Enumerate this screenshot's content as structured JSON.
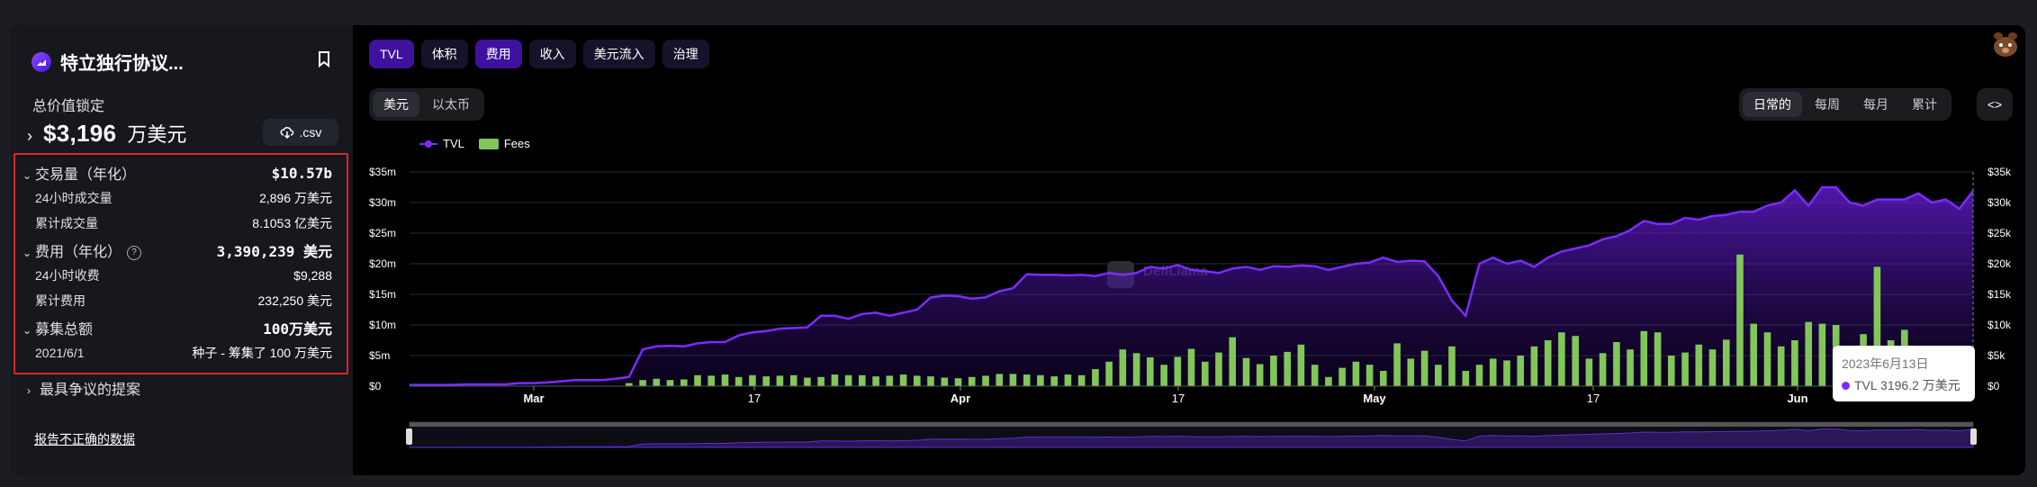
{
  "protocol": {
    "name": "特立独行协议..."
  },
  "sidebar": {
    "tvl_label": "总价值锁定",
    "tvl_value": "$3,196",
    "tvl_unit": "万美元",
    "csv_label": ".csv",
    "stats": {
      "volume_label": "交易量（年化）",
      "volume_value": "$10.57b",
      "volume_24h_label": "24小时成交量",
      "volume_24h_value": "2,896 万美元",
      "volume_cum_label": "累计成交量",
      "volume_cum_value": "8.1053 亿美元",
      "fees_label": "费用（年化）",
      "fees_value": "3,390,239 美元",
      "fees_24h_label": "24小时收费",
      "fees_24h_value": "$9,288",
      "fees_cum_label": "累计费用",
      "fees_cum_value": "232,250 美元",
      "raised_label": "募集总额",
      "raised_value": "100万美元",
      "round_date": "2021/6/1",
      "round_desc": "种子 - 筹集了 100 万美元"
    },
    "disputed_label": "最具争议的提案",
    "report_label": "报告不正确的数据"
  },
  "tabs": [
    "TVL",
    "体积",
    "费用",
    "收入",
    "美元流入",
    "治理"
  ],
  "currency_toggle": [
    "美元",
    "以太币"
  ],
  "period_toggle": [
    "日常的",
    "每周",
    "每月",
    "累计"
  ],
  "embed_label": "<>",
  "tooltip": {
    "date": "2023年6月13日",
    "value": "TVL 3196.2 万美元"
  },
  "colors": {
    "tvl": "#7b2cff",
    "fees": "#82c65a",
    "accent": "#3e129f",
    "highlight": "#e02525"
  },
  "chart_data": {
    "type": "area",
    "legend": [
      "TVL",
      "Fees"
    ],
    "x_ticks": [
      "Mar",
      "17",
      "Apr",
      "17",
      "May",
      "17",
      "Jun",
      "17"
    ],
    "y_left_ticks": [
      "$0",
      "$5m",
      "$10m",
      "$15m",
      "$20m",
      "$25m",
      "$30m",
      "$35m"
    ],
    "y_right_ticks": [
      "$0",
      "$5k",
      "$10k",
      "$15k",
      "$20k",
      "$25k",
      "$30k",
      "$35k"
    ],
    "y_left_range": [
      0,
      35
    ],
    "y_right_range": [
      0,
      35
    ],
    "watermark": "DefiLlama",
    "series": [
      {
        "name": "TVL",
        "unit": "$m",
        "values": [
          0.2,
          0.2,
          0.2,
          0.2,
          0.3,
          0.3,
          0.3,
          0.3,
          0.5,
          0.5,
          0.6,
          0.8,
          1,
          1,
          1,
          1.2,
          1.5,
          6,
          6.5,
          6.6,
          6.5,
          7,
          7.2,
          7.2,
          8.3,
          8.8,
          9,
          9.4,
          9.5,
          9.6,
          11.5,
          11.5,
          11,
          11.8,
          12,
          11.5,
          12,
          12.5,
          14.5,
          14.8,
          14.7,
          14.3,
          14.5,
          15.5,
          16,
          18.3,
          18.2,
          18.2,
          18.1,
          18.2,
          18,
          18.5,
          18.2,
          18.5,
          19.5,
          19.2,
          19.8,
          19,
          18.8,
          18.5,
          19.2,
          19.5,
          19,
          19.6,
          19.5,
          19.7,
          19.6,
          19,
          19.5,
          20,
          20.2,
          21,
          20.3,
          20.5,
          20.4,
          18,
          14,
          11.5,
          20,
          21,
          20,
          20.5,
          19.5,
          21,
          22,
          22.5,
          23,
          24,
          24.5,
          25.5,
          27,
          26.5,
          26.5,
          27.5,
          27.2,
          27.8,
          28,
          28.5,
          28.5,
          29.5,
          30,
          32,
          29.5,
          32.5,
          32.5,
          30,
          29.5,
          30.5,
          30.5,
          30.5,
          31.5,
          30,
          30.5,
          29,
          31.9
        ]
      },
      {
        "name": "Fees",
        "unit": "$k",
        "values": [
          0,
          0,
          0,
          0,
          0,
          0,
          0,
          0,
          0,
          0,
          0,
          0,
          0,
          0,
          0,
          0,
          0.5,
          1,
          1.2,
          1,
          1.1,
          1.8,
          1.7,
          1.9,
          1.5,
          1.8,
          1.6,
          1.7,
          1.8,
          1.4,
          1.5,
          1.9,
          1.8,
          1.8,
          1.6,
          1.7,
          1.9,
          1.7,
          1.6,
          1.4,
          1.3,
          1.5,
          1.7,
          2,
          2,
          1.9,
          1.8,
          1.6,
          1.9,
          1.8,
          2.8,
          4,
          6,
          5.4,
          4.7,
          3.5,
          4.8,
          6.1,
          4,
          5.5,
          8,
          4.6,
          3.6,
          5,
          5.6,
          6.8,
          3.5,
          1.5,
          3,
          4,
          3.5,
          2.5,
          7,
          4.5,
          5.8,
          3.5,
          6.5,
          2.5,
          3.5,
          4.5,
          4.2,
          5,
          6.5,
          7.5,
          8.8,
          8.2,
          4.5,
          5.4,
          7.2,
          6,
          9,
          8.8,
          5,
          5.5,
          6.8,
          6,
          7.6,
          21.5,
          10.2,
          8.8,
          6.5,
          7.5,
          10.5,
          10.2,
          10,
          1.5,
          8.5,
          19.5,
          7.5,
          9.2,
          0
        ]
      }
    ]
  }
}
